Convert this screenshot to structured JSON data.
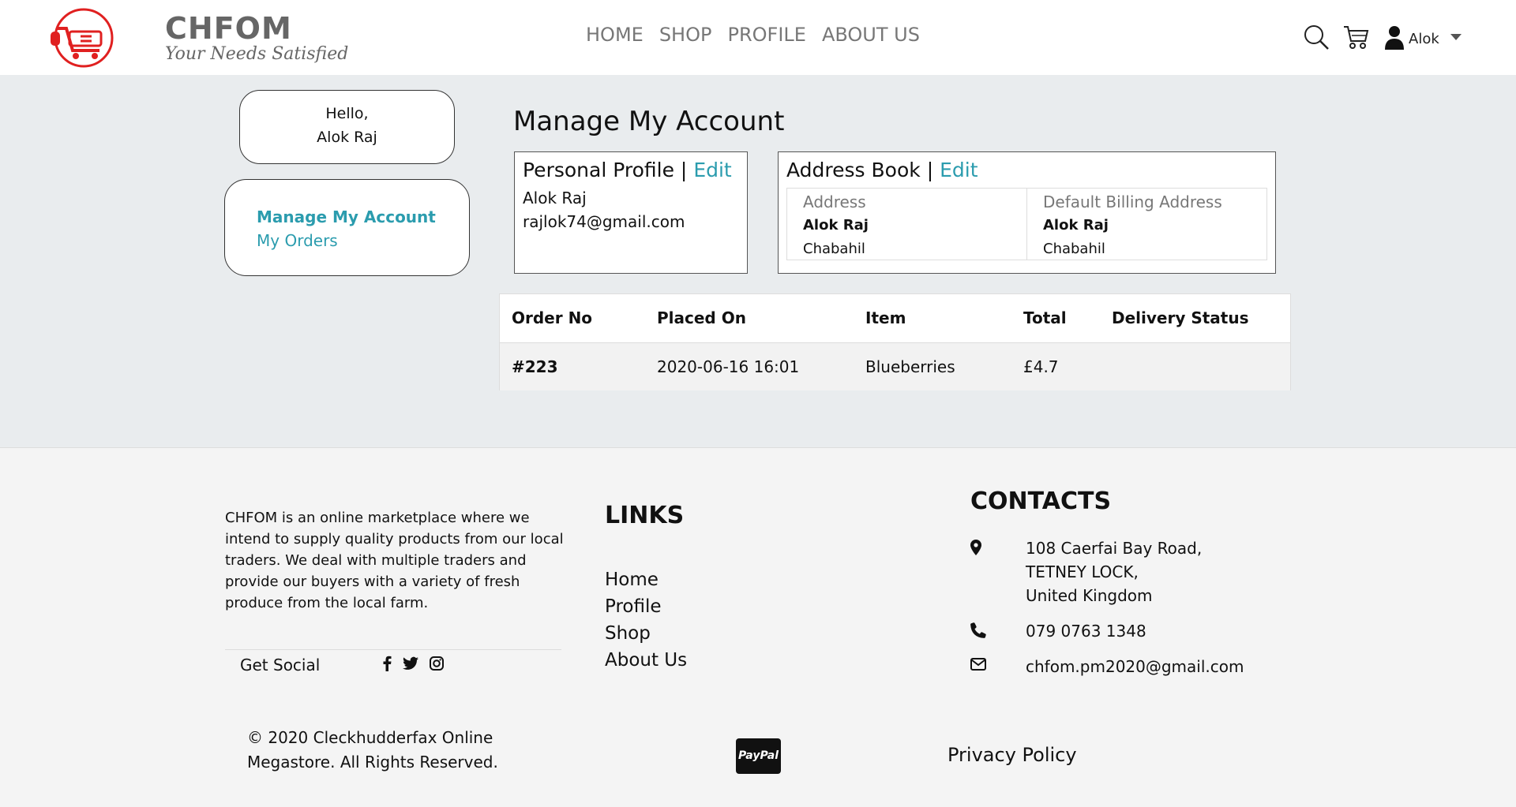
{
  "brand": {
    "name": "CHFOM",
    "tagline": "Your Needs Satisfied",
    "accent": "#e02020"
  },
  "nav": {
    "links": [
      "HOME",
      "SHOP",
      "PROFILE",
      "ABOUT US"
    ],
    "user": "Alok"
  },
  "sidebar": {
    "greeting": "Hello,",
    "user_full": "Alok Raj",
    "items": [
      {
        "label": "Manage My Account",
        "active": true
      },
      {
        "label": "My Orders",
        "active": false
      }
    ]
  },
  "main": {
    "title": "Manage My Account",
    "profile": {
      "title": "Personal Profile",
      "sep": "|",
      "edit": "Edit",
      "name": "Alok Raj",
      "email": "rajlok74@gmail.com"
    },
    "address": {
      "title": "Address Book",
      "sep": "|",
      "edit": "Edit",
      "cols": [
        {
          "head": "Address",
          "name": "Alok Raj",
          "city": "Chabahil"
        },
        {
          "head": "Default Billing Address",
          "name": "Alok Raj",
          "city": "Chabahil"
        }
      ]
    },
    "orders": {
      "headers": [
        "Order No",
        "Placed On",
        "Item",
        "Total",
        "Delivery Status"
      ],
      "rows": [
        {
          "order_no": "#223",
          "placed_on": "2020-06-16 16:01",
          "item": "Blueberries",
          "total": "£4.7",
          "status": ""
        }
      ]
    }
  },
  "footer": {
    "about": "CHFOM is an online marketplace where we intend to supply quality products from our local traders. We deal with multiple traders and provide our buyers with a variety of fresh produce from the local farm.",
    "social_label": "Get Social",
    "links_title": "LINKS",
    "links": [
      "Home",
      "Profile",
      "Shop",
      "About Us"
    ],
    "contacts_title": "CONTACTS",
    "address_lines": [
      "108 Caerfai Bay Road,",
      "TETNEY LOCK,",
      "United Kingdom"
    ],
    "phone": "079 0763 1348",
    "email": "chfom.pm2020@gmail.com",
    "copyright_1": "© 2020 Cleckhudderfax Online",
    "copyright_2": "Megastore. All Rights Reserved.",
    "paypal": "PayPal",
    "privacy": "Privacy Policy"
  },
  "colors": {
    "link": "#2b9cae",
    "bg": "#e9ecee",
    "footer_bg": "#f4f4f4"
  }
}
